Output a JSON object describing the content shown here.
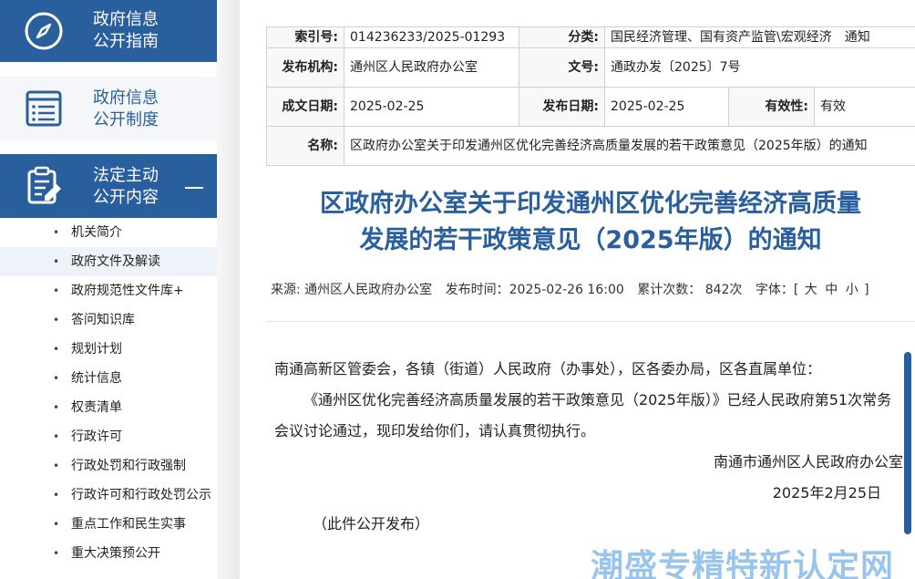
{
  "sidebar": {
    "blocks": [
      {
        "line1": "政府信息",
        "line2": "公开指南"
      },
      {
        "line1": "政府信息",
        "line2": "公开制度"
      },
      {
        "line1": "法定主动",
        "line2": "公开内容"
      }
    ],
    "items": [
      "机关简介",
      "政府文件及解读",
      "政府规范性文件库+",
      "答问知识库",
      "规划计划",
      "统计信息",
      "权责清单",
      "行政许可",
      "行政处罚和行政强制",
      "行政许可和行政处罚公示",
      "重点工作和民生实事",
      "重大决策预公开"
    ]
  },
  "meta": {
    "index_label": "索引号:",
    "index_value": "014236233/2025-01293",
    "category_label": "分类:",
    "category_value": "国民经济管理、国有资产监管\\宏观经济　通知",
    "issuer_label": "发布机构:",
    "issuer_value": "通州区人民政府办公室",
    "docno_label": "文号:",
    "docno_value": "通政办发〔2025〕7号",
    "date_label": "成文日期:",
    "date_value": "2025-02-25",
    "pubdate_label": "发布日期:",
    "pubdate_value": "2025-02-25",
    "validity_label": "有效性:",
    "validity_value": "有效",
    "name_label": "名称:",
    "name_value": "区政府办公室关于印发通州区优化完善经济高质量发展的若干政策意见（2025年版）的通知"
  },
  "article": {
    "title_line1": "区政府办公室关于印发通州区优化完善经济高质量",
    "title_line2": "发展的若干政策意见（2025年版）的通知",
    "source": "来源: 通州区人民政府办公室",
    "pubtime": "发布时间：2025-02-26 16:00",
    "views": "累计次数：  842次",
    "fontsize_label": "字体：[",
    "font_large": "大",
    "font_mid": "中",
    "font_small": "小",
    "fontsize_end": "]",
    "greeting": "南通高新区管委会，各镇（街道）人民政府（办事处），区各委办局，区各直属单位：",
    "paragraph": "《通州区优化完善经济高质量发展的若干政策意见（2025年版）》已经人民政府第51次常务会议讨论通过，现印发给你们，请认真贯彻执行。",
    "signer": "南通市通州区人民政府办公室",
    "sign_date": "2025年2月25日",
    "note": "（此件公开发布）"
  },
  "watermark": "潮盛专精特新认定网",
  "colors": {
    "brand": "#2a5f9e",
    "watermark": "#4696dc"
  }
}
